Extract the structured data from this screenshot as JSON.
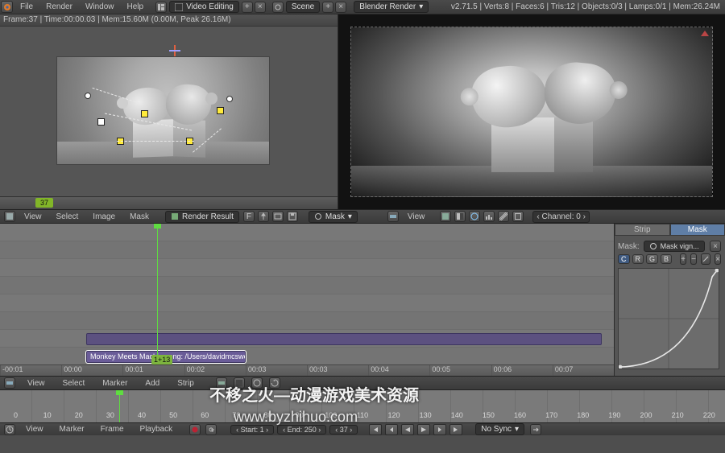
{
  "top_menu": {
    "file": "File",
    "render": "Render",
    "window": "Window",
    "help": "Help"
  },
  "screen_layout": "Video Editing",
  "scene_label": "Scene",
  "engine": "Blender Render",
  "stats": "v2.71.5 | Verts:8 | Faces:6 | Tris:12 | Objects:0/3 | Lamps:0/1 | Mem:26.24M",
  "frame_info": "Frame:37 | Time:00:00.03 | Mem:15.60M (0.00M, Peak 26.16M)",
  "left_ruler_cur": "37",
  "vse_menu": {
    "view": "View",
    "select": "Select",
    "image": "Image",
    "mask": "Mask"
  },
  "render_result": "Render Result",
  "mask_label": "Mask",
  "view_label": "View",
  "channel_label": "Channel:",
  "channel_value": "0",
  "strip_text": "Monkey Meets Machine.png: /Users/davidmcsween/D",
  "timecodes": [
    "-00:01",
    "00:00",
    "00:01",
    "00:02",
    "00:03",
    "00:03",
    "00:04",
    "00:05",
    "00:06",
    "00:07"
  ],
  "playhead_label": "1+13",
  "npanel": {
    "tabs": {
      "strip": "Strip",
      "mask": "Mask"
    },
    "mask_field_label": "Mask:",
    "mask_field_value": "Mask vign...",
    "rgbc": [
      "C",
      "R",
      "G",
      "B"
    ]
  },
  "vse2_menu": {
    "view": "View",
    "select": "Select",
    "marker": "Marker",
    "add": "Add",
    "strip": "Strip"
  },
  "timeline_nums": [
    "0",
    "10",
    "20",
    "30",
    "40",
    "50",
    "60",
    "70",
    "80",
    "90",
    "100",
    "110",
    "120",
    "130",
    "140",
    "150",
    "160",
    "170",
    "180",
    "190",
    "200",
    "210",
    "220"
  ],
  "tl_footer": {
    "menu": {
      "view": "View",
      "marker": "Marker",
      "frame": "Frame",
      "playback": "Playback"
    },
    "start_label": "Start:",
    "start_val": "1",
    "end_label": "End:",
    "end_val": "250",
    "cur_val": "37",
    "sync": "No Sync"
  },
  "watermark_a": "不移之火—动漫游戏美术资源",
  "watermark_b": "www.byzhihuo.com"
}
